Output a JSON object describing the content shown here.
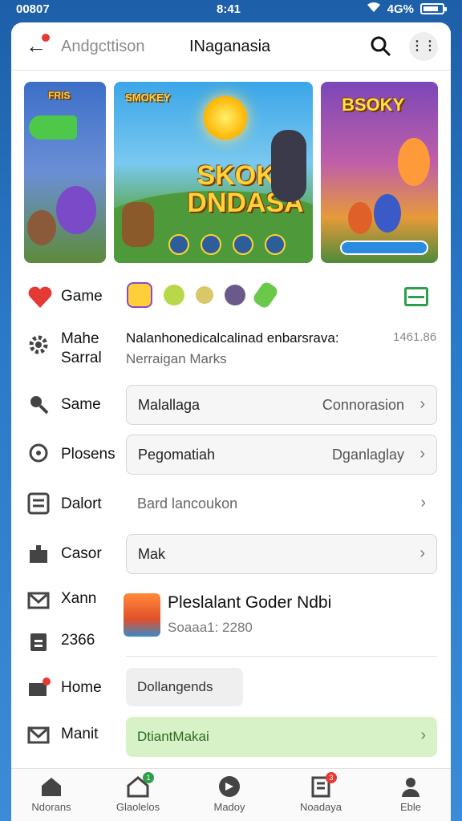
{
  "statusbar": {
    "left": "00807",
    "time": "8:41",
    "right": "4G%"
  },
  "topbar": {
    "crumb": "Andgcttison",
    "title": "INaganasia"
  },
  "banners": {
    "left_title": "FRIS",
    "center_top": "SMOKEY",
    "center_big": "SKOKY DNDASA",
    "right_title": "BSOKY"
  },
  "rows": {
    "game": {
      "label": "Game"
    },
    "info": {
      "label": "Mahe Sarral",
      "title": "Nalanhonedicalcalinad enbarsrava:",
      "subtitle": "Nerraigan Marks",
      "number": "1461.86"
    },
    "same": {
      "label": "Same",
      "value": "Malallaga",
      "right": "Connorasion"
    },
    "plosens": {
      "label": "Plosens",
      "value": "Pegomatiah",
      "right": "Dganlaglay"
    },
    "dalort": {
      "label": "Dalort",
      "value": "Bard lancoukon"
    },
    "casor": {
      "label": "Casor",
      "value": "Mak"
    },
    "xann": {
      "label": "Xann"
    },
    "num": {
      "label": "2366"
    },
    "home": {
      "label": "Home",
      "chip": "Dollangends"
    },
    "manit": {
      "label": "Manit",
      "action": "DtiantMakai"
    }
  },
  "profile": {
    "name": "Pleslalant Goder Ndbi",
    "sub": "Soaaa1: 2280"
  },
  "tabs": [
    {
      "label": "Ndorans"
    },
    {
      "label": "Glaolelos",
      "badge": "1"
    },
    {
      "label": "Madoy"
    },
    {
      "label": "Noadaya",
      "badge": "3"
    },
    {
      "label": "Eble"
    }
  ],
  "colors": {
    "accent_green": "#2e9e4a",
    "badge_red": "#e53935",
    "heart_red": "#e53935"
  }
}
